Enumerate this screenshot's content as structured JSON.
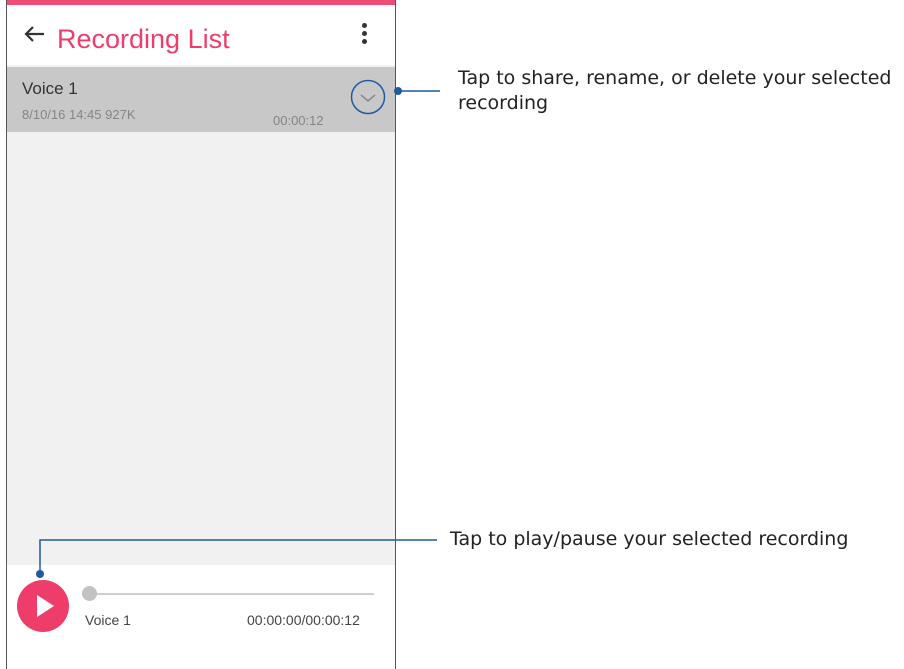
{
  "app_bar": {
    "title": "Recording List",
    "back_icon": "arrow-left-icon",
    "menu_icon": "more-vertical-icon"
  },
  "recordings": [
    {
      "name": "Voice 1",
      "meta": "8/10/16 14:45   927K",
      "duration": "00:00:12"
    }
  ],
  "player": {
    "name": "Voice 1",
    "time": "00:00:00/00:00:12",
    "progress": 0
  },
  "callouts": {
    "options": "Tap to share, rename, or delete your selected recording",
    "play": "Tap to play/pause your selected recording"
  },
  "colors": {
    "accent": "#ef3d6b",
    "callout_line": "#1f5aa0",
    "selected_row": "#c8c8c8"
  }
}
